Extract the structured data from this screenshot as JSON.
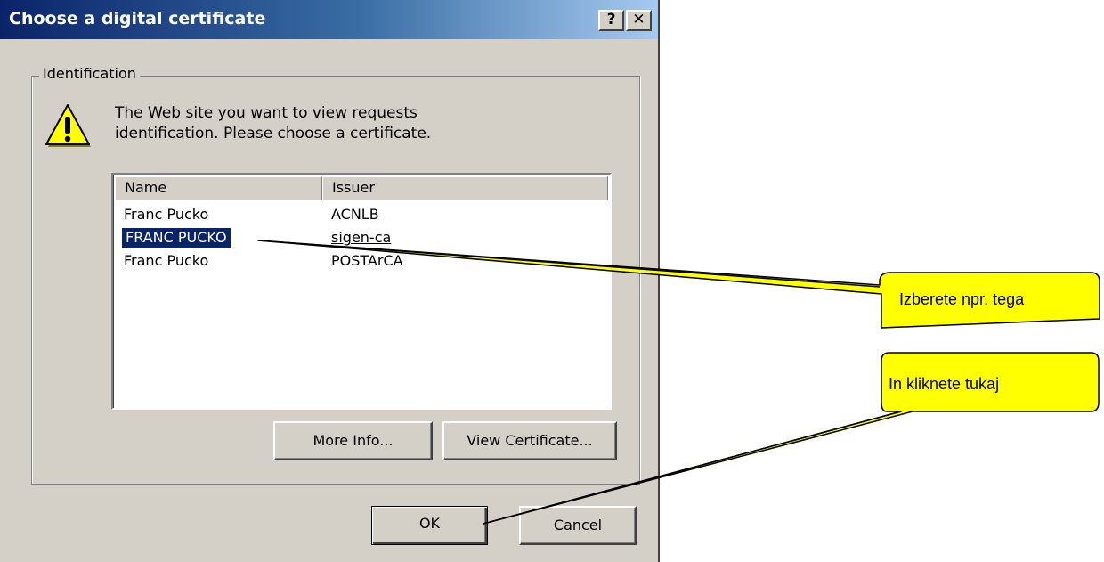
{
  "dialog": {
    "title": "Choose a digital certificate",
    "help_button": "?",
    "close_button": "✕",
    "group_label": "Identification",
    "message_line1": "The Web site you want to view requests",
    "message_line2": "identification. Please choose a certificate."
  },
  "certificates": {
    "columns": [
      "Name",
      "Issuer"
    ],
    "rows": [
      {
        "name": "Franc Pucko",
        "issuer": "ACNLB",
        "selected": false
      },
      {
        "name": "FRANC PUCKO",
        "issuer": "sigen-ca",
        "selected": true
      },
      {
        "name": "Franc Pucko",
        "issuer": "POSTArCA",
        "selected": false
      }
    ]
  },
  "buttons": {
    "more_info": "More Info...",
    "view_certificate": "View Certificate...",
    "ok": "OK",
    "cancel": "Cancel"
  },
  "callouts": {
    "select_hint": "Izberete npr. tega",
    "click_hint": "In kliknete tukaj"
  },
  "colors": {
    "callout_fill": "#ffff00",
    "title_bar": "#0a246a",
    "selection": "#0a246a",
    "dialog_face": "#d4d0c8"
  },
  "icons": {
    "warning": "warning-icon"
  }
}
